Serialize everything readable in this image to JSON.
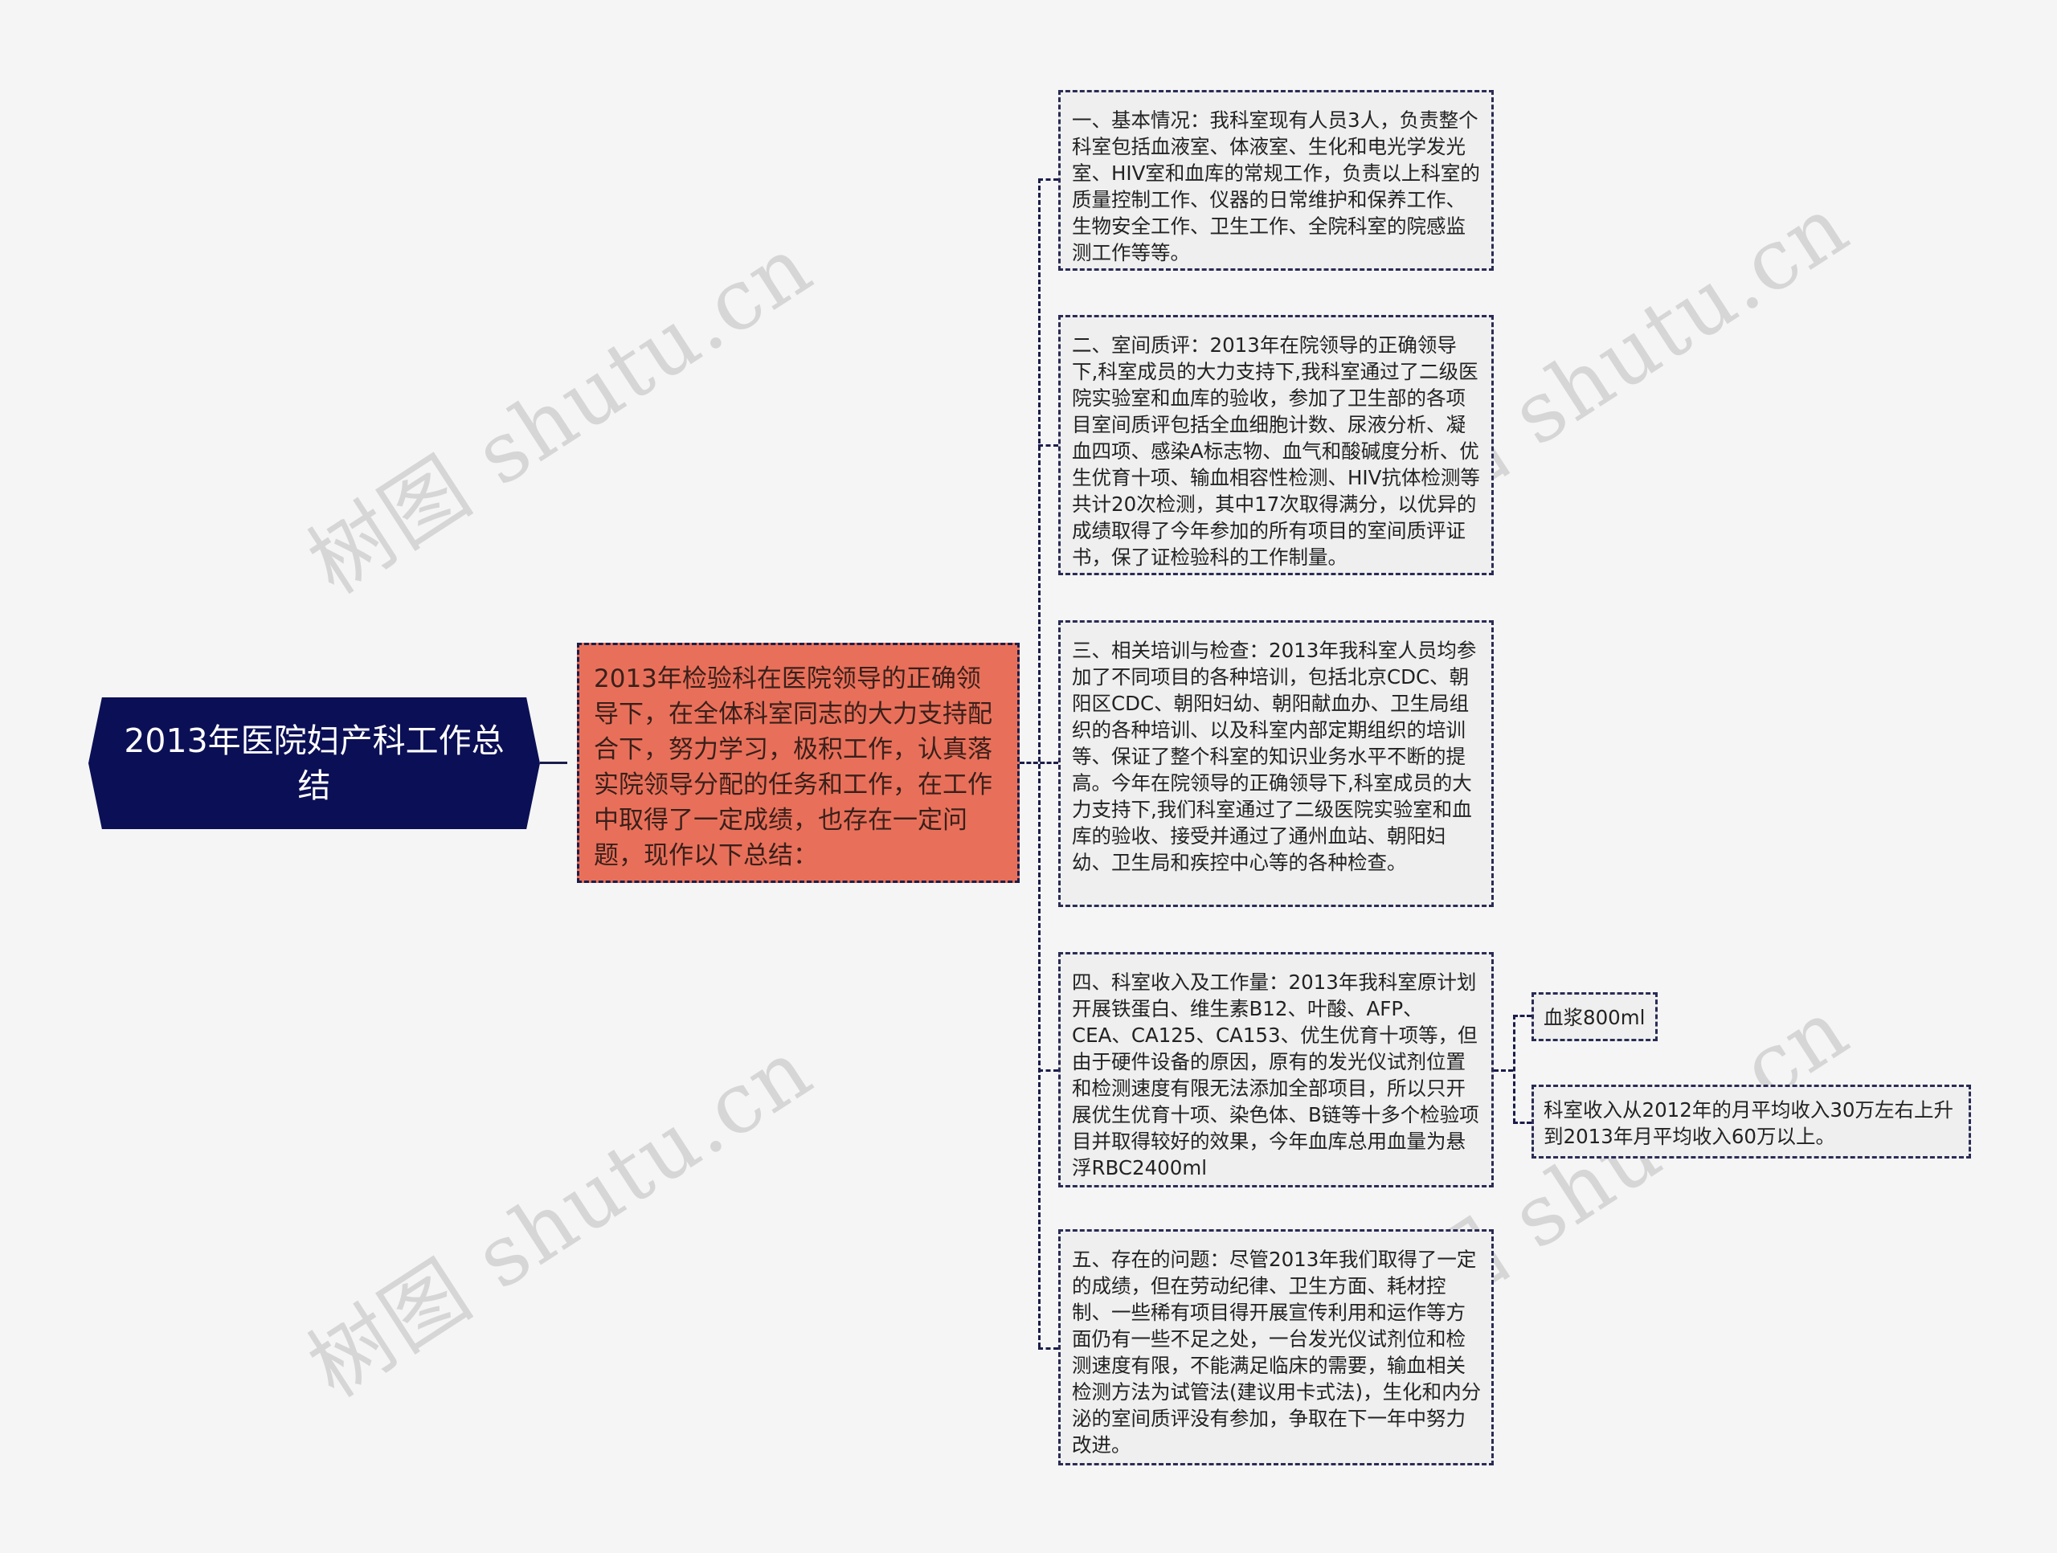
{
  "watermark": {
    "text": "树图 shutu.cn"
  },
  "root": {
    "title": "2013年医院妇产科工作总结"
  },
  "center": {
    "text": "2013年检验科在医院领导的正确领导下，在全体科室同志的大力支持配合下，努力学习，极积工作，认真落实院领导分配的任务和工作，在工作中取得了一定成绩，也存在一定问题，现作以下总结："
  },
  "branches": [
    {
      "text": "一、基本情况：我科室现有人员3人，负责整个科室包括血液室、体液室、生化和电光学发光室、HIV室和血库的常规工作，负责以上科室的质量控制工作、仪器的日常维护和保养工作、生物安全工作、卫生工作、全院科室的院感监测工作等等。"
    },
    {
      "text": "二、室间质评：2013年在院领导的正确领导下,科室成员的大力支持下,我科室通过了二级医院实验室和血库的验收，参加了卫生部的各项目室间质评包括全血细胞计数、尿液分析、凝血四项、感染A标志物、血气和酸碱度分析、优生优育十项、输血相容性检测、HIV抗体检测等共计20次检测，其中17次取得满分，以优异的成绩取得了今年参加的所有项目的室间质评证书，保了证检验科的工作制量。"
    },
    {
      "text": "三、相关培训与检查：2013年我科室人员均参加了不同项目的各种培训，包括北京CDC、朝阳区CDC、朝阳妇幼、朝阳献血办、卫生局组织的各种培训、以及科室内部定期组织的培训等、保证了整个科室的知识业务水平不断的提高。今年在院领导的正确领导下,科室成员的大力支持下,我们科室通过了二级医院实验室和血库的验收、接受并通过了通州血站、朝阳妇幼、卫生局和疾控中心等的各种检查。"
    },
    {
      "text": "四、科室收入及工作量：2013年我科室原计划开展铁蛋白、维生素B12、叶酸、AFP、CEA、CA125、CA153、优生优育十项等，但由于硬件设备的原因，原有的发光仪试剂位置和检测速度有限无法添加全部项目，所以只开展优生优育十项、染色体、B链等十多个检验项目并取得较好的效果，今年血库总用血量为悬浮RBC2400ml",
      "children": [
        {
          "text": "血浆800ml"
        },
        {
          "text": "科室收入从2012年的月平均收入30万左右上升到2013年月平均收入60万以上。"
        }
      ]
    },
    {
      "text": "五、存在的问题：尽管2013年我们取得了一定的成绩，但在劳动纪律、卫生方面、耗材控制、一些稀有项目得开展宣传利用和运作等方面仍有一些不足之处，一台发光仪试剂位和检测速度有限，不能满足临床的需要，输血相关检测方法为试管法(建议用卡式法)，生化和内分泌的室间质评没有参加，争取在下一年中努力改进。"
    }
  ]
}
